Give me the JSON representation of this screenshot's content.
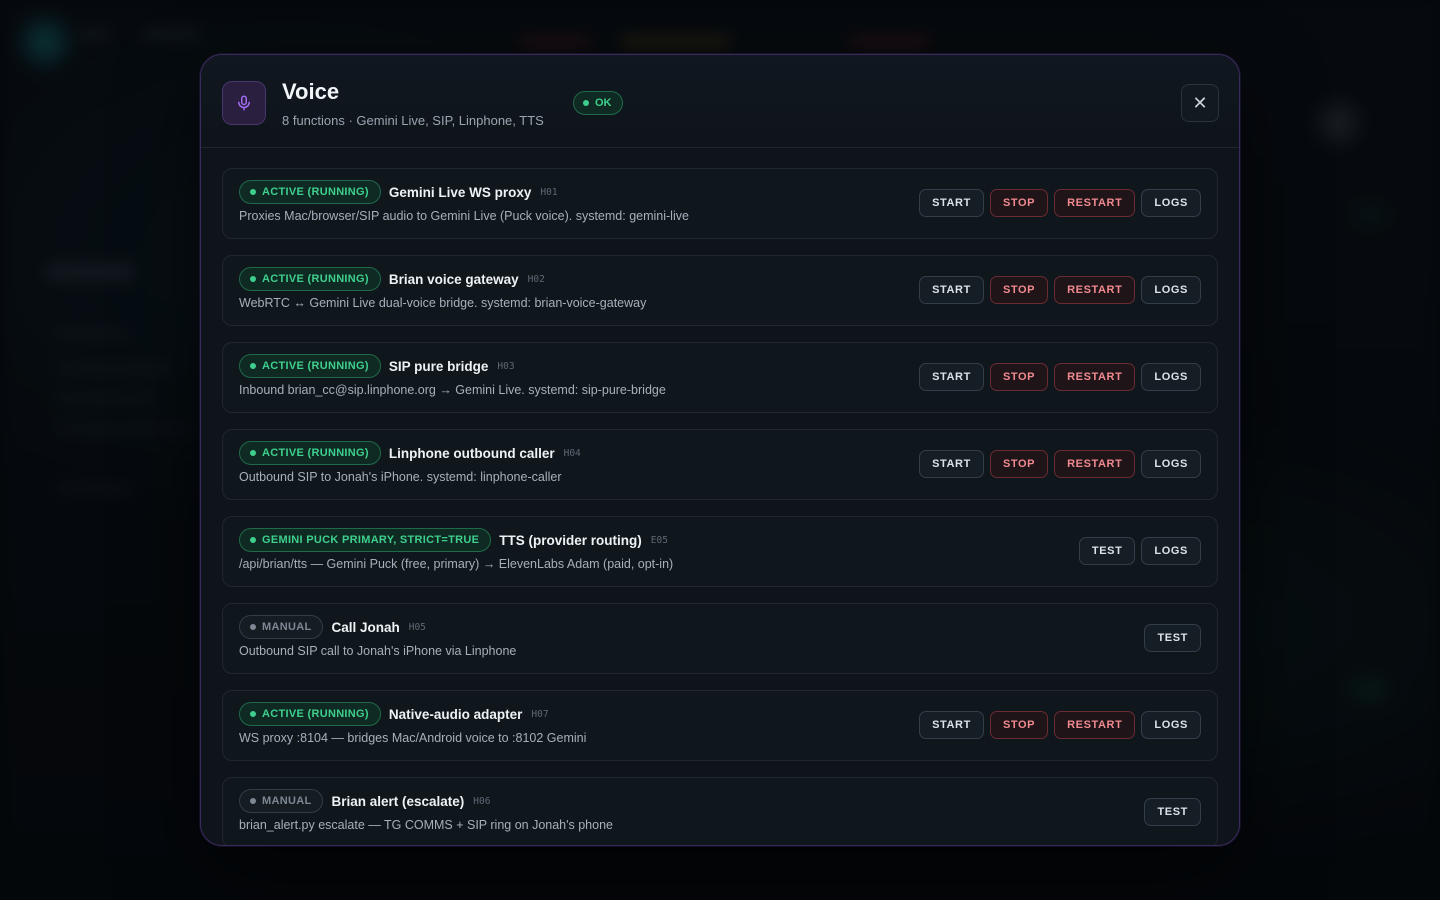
{
  "modal": {
    "title": "Voice",
    "subtitle": "8 functions · Gemini Live, SIP, Linphone, TTS",
    "status_badge": "OK",
    "close_label": "✕"
  },
  "colors": {
    "accent": "#a06cf0",
    "ok": "#3ecf8e",
    "danger": "#f08a8f",
    "border": "#3d2a5c"
  },
  "icons": {
    "header": "microphone-icon",
    "close": "close-icon"
  },
  "functions": [
    {
      "status": "ACTIVE (RUNNING)",
      "status_kind": "active",
      "name": "Gemini Live WS proxy",
      "code": "H01",
      "description": "Proxies Mac/browser/SIP audio to Gemini Live (Puck voice). systemd: gemini-live",
      "actions": [
        "START",
        "STOP",
        "RESTART",
        "LOGS"
      ]
    },
    {
      "status": "ACTIVE (RUNNING)",
      "status_kind": "active",
      "name": "Brian voice gateway",
      "code": "H02",
      "description": "WebRTC ↔ Gemini Live dual-voice bridge. systemd: brian-voice-gateway",
      "actions": [
        "START",
        "STOP",
        "RESTART",
        "LOGS"
      ]
    },
    {
      "status": "ACTIVE (RUNNING)",
      "status_kind": "active",
      "name": "SIP pure bridge",
      "code": "H03",
      "description": "Inbound brian_cc@sip.linphone.org → Gemini Live. systemd: sip-pure-bridge",
      "actions": [
        "START",
        "STOP",
        "RESTART",
        "LOGS"
      ]
    },
    {
      "status": "ACTIVE (RUNNING)",
      "status_kind": "active",
      "name": "Linphone outbound caller",
      "code": "H04",
      "description": "Outbound SIP to Jonah's iPhone. systemd: linphone-caller",
      "actions": [
        "START",
        "STOP",
        "RESTART",
        "LOGS"
      ]
    },
    {
      "status": "GEMINI PUCK PRIMARY, STRICT=TRUE",
      "status_kind": "active",
      "name": "TTS (provider routing)",
      "code": "E05",
      "description": "/api/brian/tts — Gemini Puck (free, primary) → ElevenLabs Adam (paid, opt-in)",
      "actions": [
        "TEST",
        "LOGS"
      ]
    },
    {
      "status": "MANUAL",
      "status_kind": "manual",
      "name": "Call Jonah",
      "code": "H05",
      "description": "Outbound SIP call to Jonah's iPhone via Linphone",
      "actions": [
        "TEST"
      ]
    },
    {
      "status": "ACTIVE (RUNNING)",
      "status_kind": "active",
      "name": "Native-audio adapter",
      "code": "H07",
      "description": "WS proxy :8104 — bridges Mac/Android voice to :8102 Gemini",
      "actions": [
        "START",
        "STOP",
        "RESTART",
        "LOGS"
      ]
    },
    {
      "status": "MANUAL",
      "status_kind": "manual",
      "name": "Brian alert (escalate)",
      "code": "H06",
      "description": "brian_alert.py escalate — TG COMMS + SIP ring on Jonah's phone",
      "actions": [
        "TEST"
      ]
    }
  ]
}
